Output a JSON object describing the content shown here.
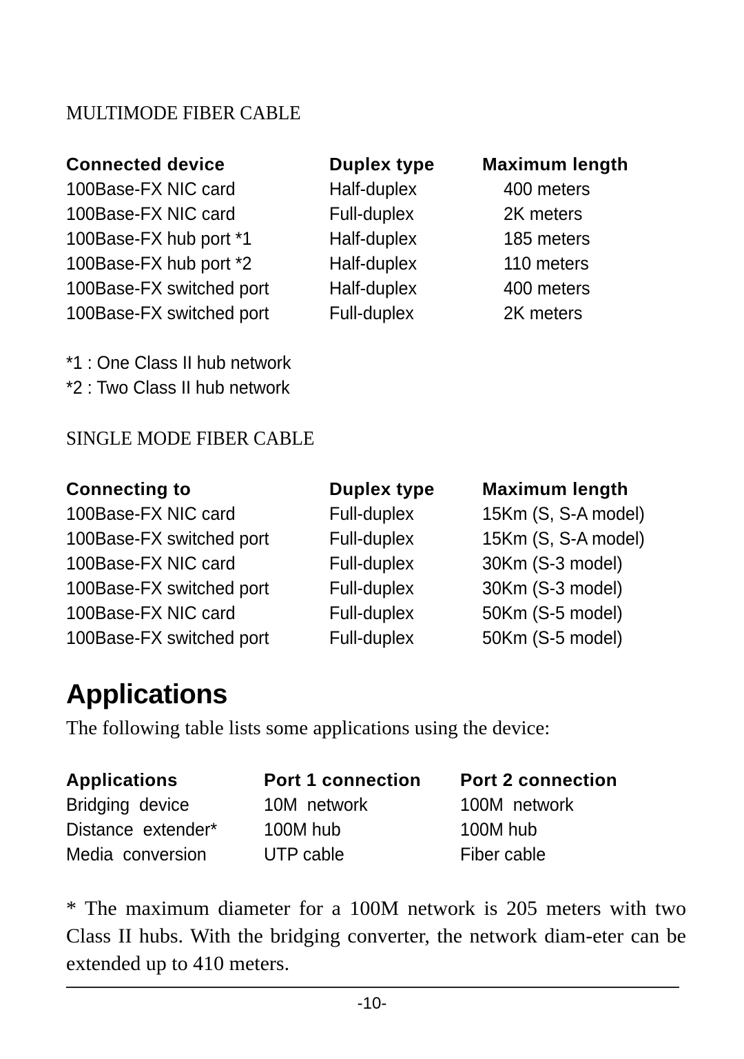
{
  "multimode": {
    "title": "MULTIMODE  FIBER  CABLE",
    "headers": [
      "Connected device",
      "Duplex type",
      "Maximum length"
    ],
    "rows": [
      [
        "100Base-FX NIC card",
        "Half-duplex",
        "400 meters"
      ],
      [
        "100Base-FX NIC card",
        "Full-duplex",
        "2K meters"
      ],
      [
        "100Base-FX hub port *1",
        "Half-duplex",
        "185 meters"
      ],
      [
        "100Base-FX hub port *2",
        "Half-duplex",
        "110 meters"
      ],
      [
        "100Base-FX switched port",
        "Half-duplex",
        "400 meters"
      ],
      [
        "100Base-FX switched port",
        "Full-duplex",
        "2K meters"
      ]
    ],
    "notes": [
      "*1 : One Class II hub network",
      "*2 : Two Class II hub network"
    ]
  },
  "singlemode": {
    "title": "SINGLE MODE FIBER CABLE",
    "headers": [
      "Connecting to",
      "Duplex type",
      "Maximum length"
    ],
    "rows": [
      [
        "100Base-FX NIC card",
        "Full-duplex",
        "15Km (S, S-A model)"
      ],
      [
        "100Base-FX switched port",
        "Full-duplex",
        "15Km (S, S-A model)"
      ],
      [
        "100Base-FX NIC card",
        "Full-duplex",
        "30Km (S-3 model)"
      ],
      [
        "100Base-FX switched port",
        "Full-duplex",
        "30Km (S-3 model)"
      ],
      [
        "100Base-FX NIC card",
        "Full-duplex",
        "50Km (S-5 model)"
      ],
      [
        "100Base-FX switched port",
        "Full-duplex",
        "50Km (S-5 model)"
      ]
    ]
  },
  "applications": {
    "heading": "Applications",
    "intro": "The following table lists some applications using the device:",
    "headers": [
      "Applications",
      "Port 1 connection",
      "Port 2 connection"
    ],
    "rows": [
      [
        "Bridging  device",
        "10M  network",
        "100M  network"
      ],
      [
        "Distance  extender*",
        "100M hub",
        "100M hub"
      ],
      [
        "Media  conversion",
        "UTP cable",
        "Fiber cable"
      ]
    ],
    "footnote": "* The maximum diameter for a 100M network is 205 meters with two Class II hubs. With the bridging converter, the network diam-eter can be extended up to 410 meters."
  },
  "footer": {
    "page_number": "-10-"
  }
}
